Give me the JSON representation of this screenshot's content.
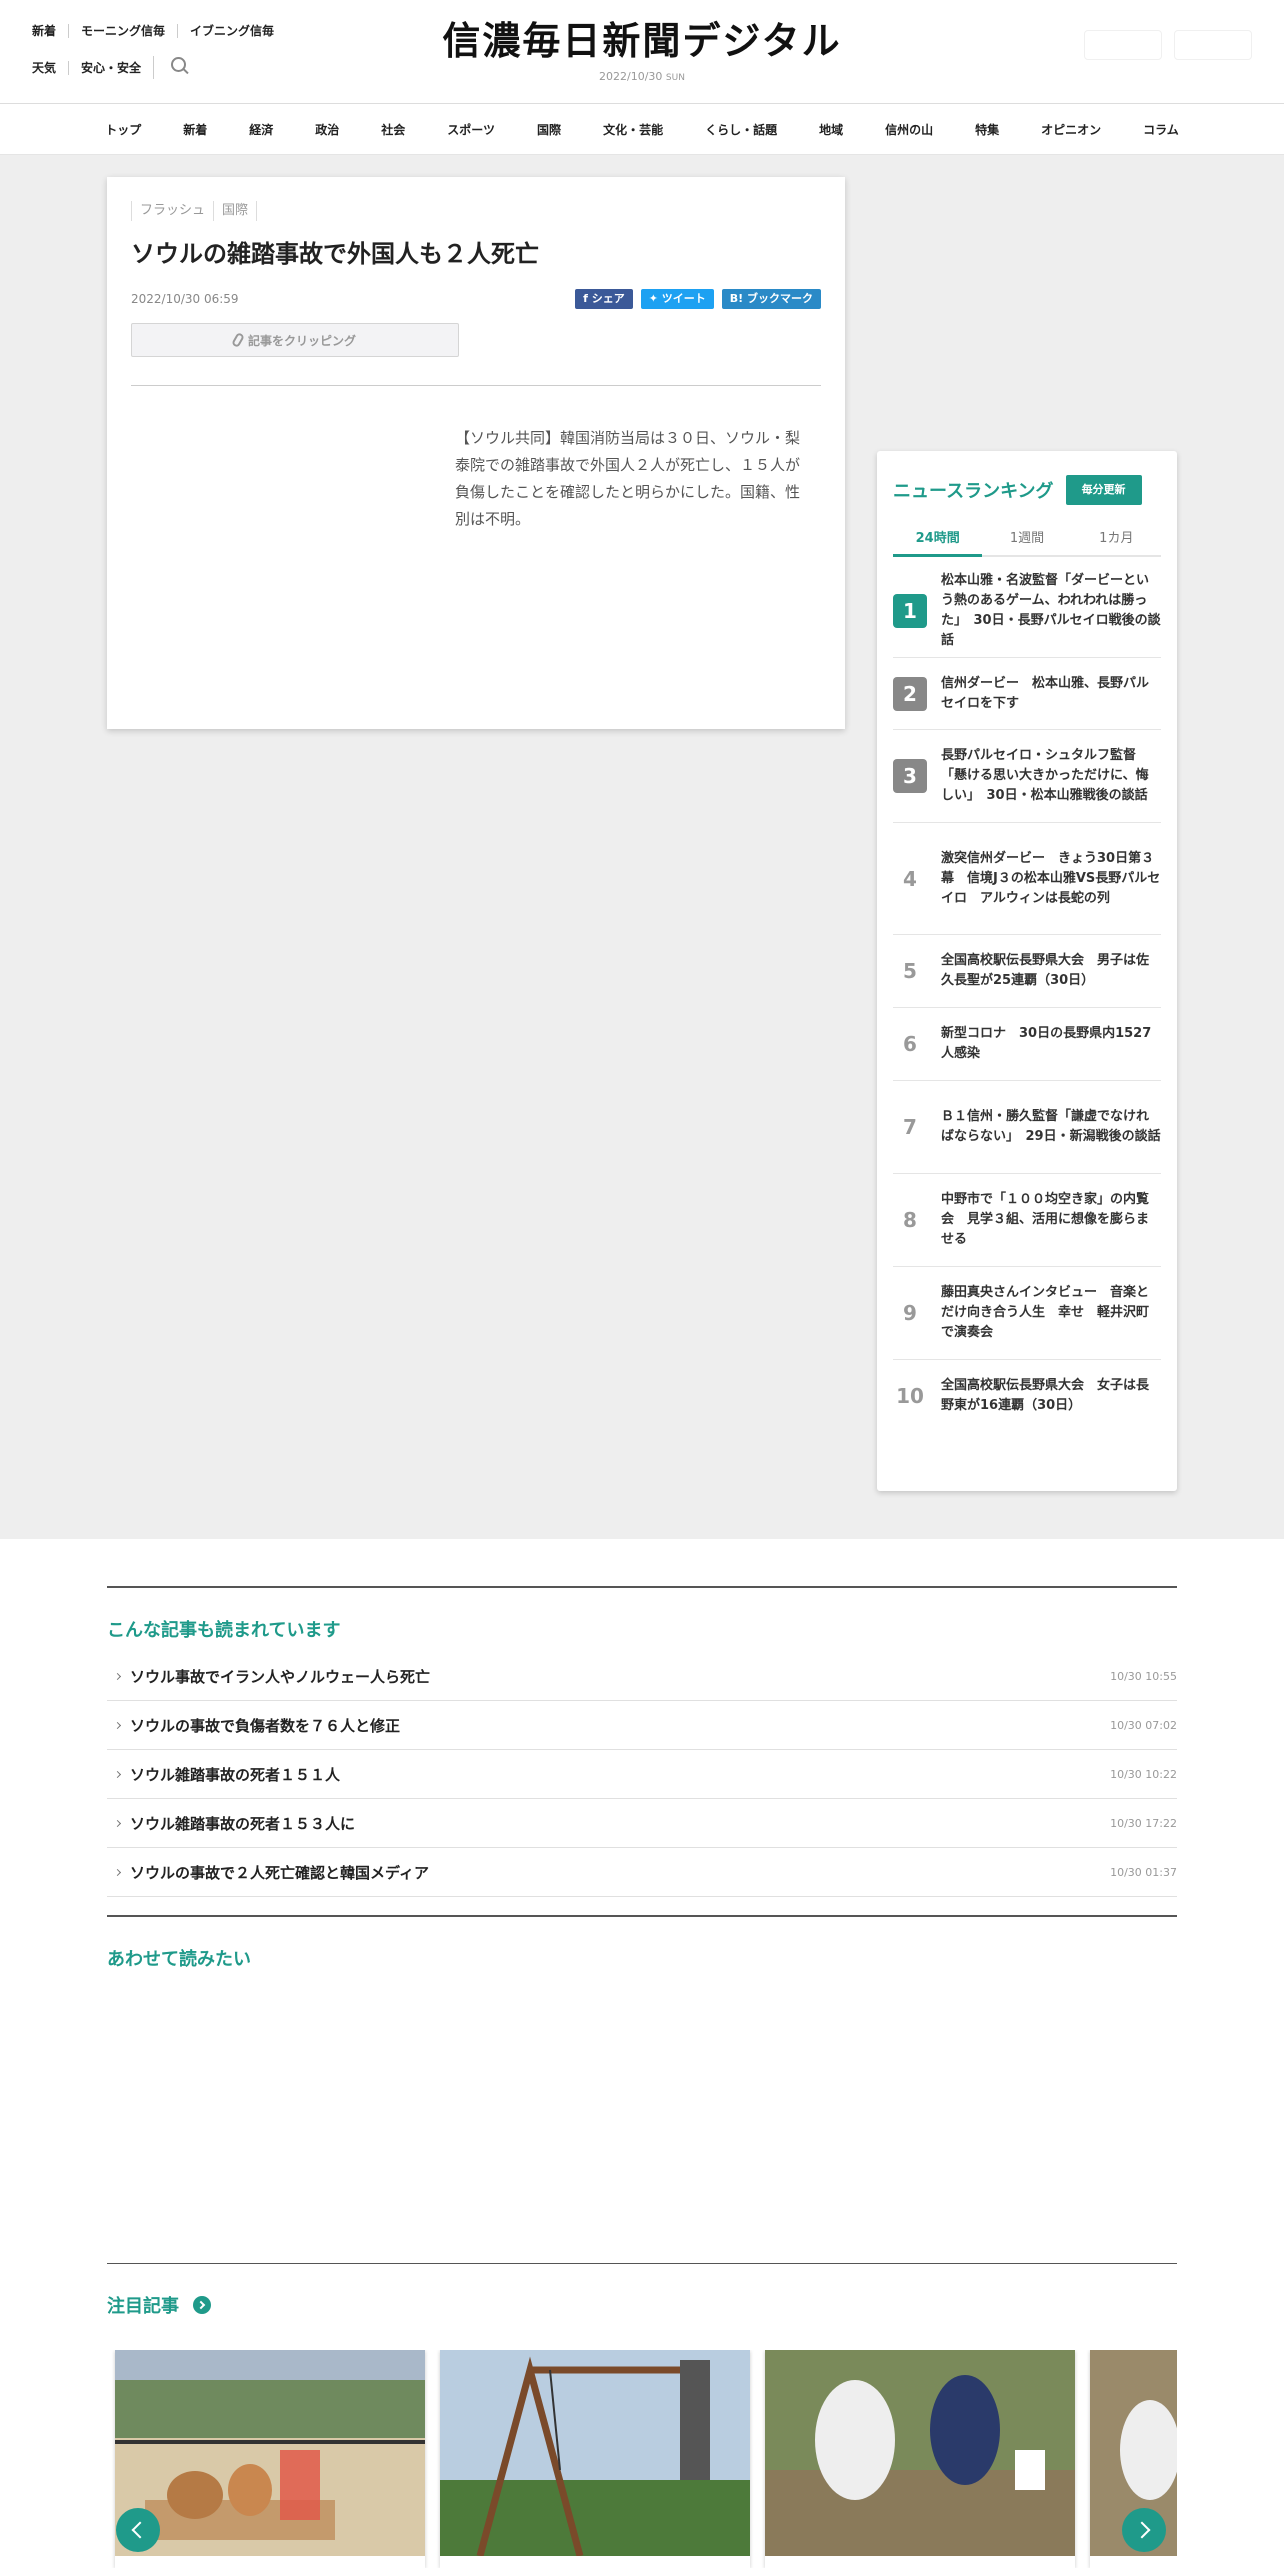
{
  "header": {
    "nav_row1": [
      "新着",
      "モーニング信毎",
      "イブニング信毎"
    ],
    "nav_row2": [
      "天気",
      "安心・安全"
    ],
    "logo": "信濃毎日新聞デジタル",
    "date": "2022/10/30",
    "weekday": "SUN"
  },
  "categories": [
    "トップ",
    "新着",
    "経済",
    "政治",
    "社会",
    "スポーツ",
    "国際",
    "文化・芸能",
    "くらし・話題",
    "地域",
    "信州の山",
    "特集",
    "オピニオン",
    "コラム"
  ],
  "article": {
    "tags": [
      "フラッシュ",
      "国際"
    ],
    "title": "ソウルの雑踏事故で外国人も２人死亡",
    "date": "2022/10/30 06:59",
    "share": {
      "facebook": "シェア",
      "twitter": "ツイート",
      "hatena": "B! ブックマーク"
    },
    "clip_label": "記事をクリッピング",
    "body": "【ソウル共同】韓国消防当局は３０日、ソウル・梨泰院での雑踏事故で外国人２人が死亡し、１５人が負傷したことを確認したと明らかにした。国籍、性別は不明。"
  },
  "ranking": {
    "title": "ニュースランキング",
    "badge": "毎分更新",
    "tabs": [
      "24時間",
      "1週間",
      "1カ月"
    ],
    "items": [
      {
        "rank": "1",
        "text": "松本山雅・名波監督「ダービーという熱のあるゲーム、われわれは勝った」　30日・長野パルセイロ戦後の談話"
      },
      {
        "rank": "2",
        "text": "信州ダービー　松本山雅、長野パルセイロを下す"
      },
      {
        "rank": "3",
        "text": "長野パルセイロ・シュタルフ監督「懸ける思い大きかっただけに、悔しい」　30日・松本山雅戦後の談話"
      },
      {
        "rank": "4",
        "text": "激突信州ダービー　きょう30日第３幕　信境J３の松本山雅VS長野パルセイロ　アルウィンは長蛇の列"
      },
      {
        "rank": "5",
        "text": "全国高校駅伝長野県大会　男子は佐久長聖が25連覇（30日）"
      },
      {
        "rank": "6",
        "text": "新型コロナ　30日の長野県内1527人感染"
      },
      {
        "rank": "7",
        "text": "Ｂ１信州・勝久監督「謙虚でなければならない」　29日・新潟戦後の談話"
      },
      {
        "rank": "8",
        "text": "中野市で「１００均空き家」の内覧会　見学３組、活用に想像を膨らませる"
      },
      {
        "rank": "9",
        "text": "藤田真央さんインタビュー　音楽とだけ向き合う人生　幸せ　軽井沢町で演奏会"
      },
      {
        "rank": "10",
        "text": "全国高校駅伝長野県大会　女子は長野東が16連覇（30日）"
      }
    ]
  },
  "related": {
    "title": "こんな記事も読まれています",
    "items": [
      {
        "title": "ソウル事故でイラン人やノルウェー人ら死亡",
        "time": "10/30 10:55"
      },
      {
        "title": "ソウルの事故で負傷者数を７６人と修正",
        "time": "10/30 07:02"
      },
      {
        "title": "ソウル雑踏事故の死者１５１人",
        "time": "10/30 10:22"
      },
      {
        "title": "ソウル雑踏事故の死者１５３人に",
        "time": "10/30 17:22"
      },
      {
        "title": "ソウルの事故で２人死亡確認と韓国メディア",
        "time": "10/30 01:37"
      }
    ]
  },
  "also_read": {
    "title": "あわせて読みたい"
  },
  "featured": {
    "title": "注目記事"
  },
  "colors": {
    "accent": "#1f9a8a",
    "grey_bg": "#eeeeee"
  }
}
